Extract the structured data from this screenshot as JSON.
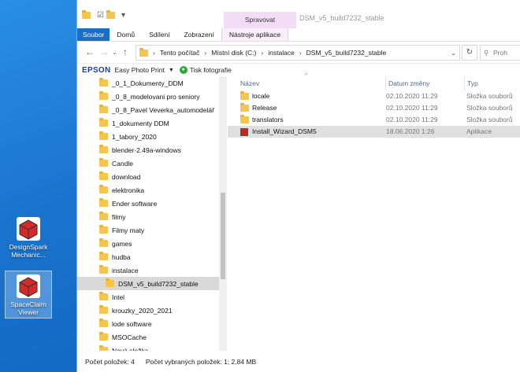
{
  "desktop": {
    "icons": [
      {
        "label": "DesignSpark Mechanic...",
        "icon": "designspark-cube-icon"
      },
      {
        "label": "SpaceClaim Viewer",
        "icon": "spaceclaim-cube-icon"
      }
    ]
  },
  "window": {
    "title": "DSM_v5_build7232_stable",
    "context_tab_header": "Spravovat",
    "ribbon_tabs": [
      "Soubor",
      "Domů",
      "Sdílení",
      "Zobrazení",
      "Nástroje aplikace"
    ]
  },
  "address": {
    "path": [
      "Tento počítač",
      "Místní disk (C:)",
      "instalace",
      "DSM_v5_build7232_stable"
    ],
    "search_placeholder": "Proh"
  },
  "epson_toolbar": {
    "brand": "EPSON",
    "item1": "Easy Photo Print",
    "item2": "Tisk fotografie"
  },
  "nav_tree": [
    "_0_1_Dokumenty_DDM",
    "_0_8_modelovani pro seniory",
    "_0_8_Pavel Veverka_automodelář",
    "1_dokumenty DDM",
    "1_tabory_2020",
    "blender-2.49a-windows",
    "Candle",
    "download",
    "elektronika",
    "Ender software",
    "filmy",
    "Filmy maty",
    "games",
    "hudba",
    "instalace",
    "DSM_v5_build7232_stable",
    "Intel",
    "krouzky_2020_2021",
    "lode software",
    "MSOCache",
    "Nová složka"
  ],
  "nav_selected_index": 15,
  "columns": {
    "name": "Název",
    "date": "Datum změny",
    "type": "Typ"
  },
  "files": [
    {
      "name": "locale",
      "date": "02.10.2020 11:29",
      "type": "Složka souborů",
      "kind": "folder"
    },
    {
      "name": "Release",
      "date": "02.10.2020 11:29",
      "type": "Složka souborů",
      "kind": "folder"
    },
    {
      "name": "translators",
      "date": "02.10.2020 11:29",
      "type": "Složka souborů",
      "kind": "folder"
    },
    {
      "name": "Install_Wizard_DSM5",
      "date": "18.06.2020 1:26",
      "type": "Aplikace",
      "kind": "app"
    }
  ],
  "status": {
    "items": "Počet položek: 4",
    "selected": "Počet vybraných položek: 1; 2,84 MB"
  },
  "colors": {
    "ribbon_file_tab": "#1a6fc4",
    "context_tab": "#f3dcf5",
    "folder": "#f5c64f",
    "selection": "#d9d9d9"
  }
}
